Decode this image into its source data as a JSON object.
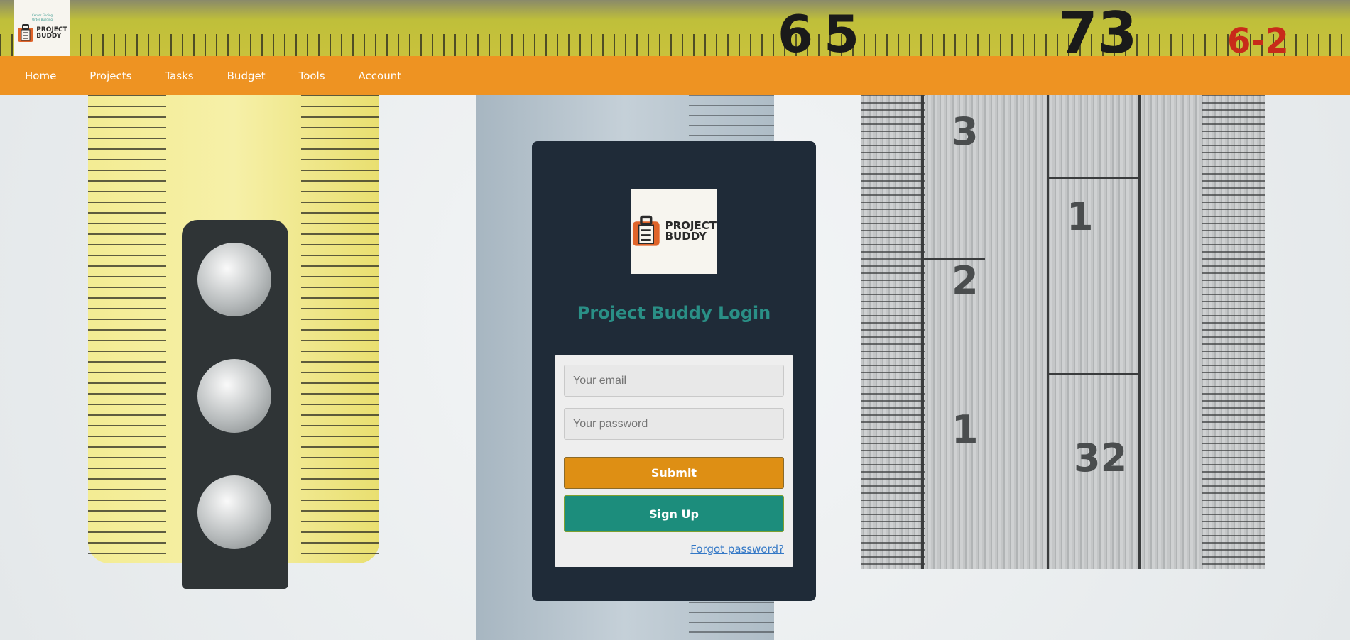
{
  "brand": {
    "name_line1": "PROJECT",
    "name_line2": "BUDDY",
    "tagline_line1": "Center Finding",
    "tagline_line2": "Order Building",
    "accent_color": "#ee9322",
    "title_color": "#2a8f86"
  },
  "background": {
    "top_tape_numbers": [
      "6",
      "5",
      "73",
      "6-2"
    ],
    "ruler_numbers": [
      "3",
      "1",
      "2",
      "1",
      "32"
    ]
  },
  "nav": {
    "items": [
      {
        "label": "Home",
        "icon": "home"
      },
      {
        "label": "Projects",
        "icon": "projects"
      },
      {
        "label": "Tasks",
        "icon": "tasks"
      },
      {
        "label": "Budget",
        "icon": "budget"
      },
      {
        "label": "Tools",
        "icon": "tools"
      },
      {
        "label": "Account",
        "icon": "account"
      }
    ]
  },
  "login": {
    "title": "Project Buddy Login",
    "email_placeholder": "Your email",
    "email_value": "",
    "password_placeholder": "Your password",
    "password_value": "",
    "submit_label": "Submit",
    "signup_label": "Sign Up",
    "forgot_label": "Forgot password?",
    "submit_color": "#de8f14",
    "signup_color": "#1c8d7c"
  }
}
